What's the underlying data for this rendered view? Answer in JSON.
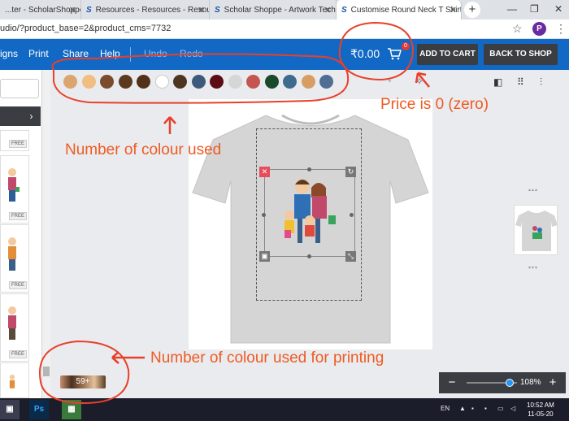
{
  "browser": {
    "tabs": [
      {
        "title": "...ter - ScholarShoppe",
        "active": false
      },
      {
        "title": "Resources - Resources - Resour",
        "active": false
      },
      {
        "title": "Scholar Shoppe - Artwork Techn",
        "active": false
      },
      {
        "title": "Customise Round Neck T Shirt |",
        "active": true
      }
    ],
    "new_tab": "+",
    "url": "udio/?product_base=2&product_cms=7732",
    "profile_initial": "P"
  },
  "app": {
    "menu": [
      "igns",
      "Print",
      "Share",
      "Help"
    ],
    "undo": "Undo",
    "redo": "Redo",
    "price": "₹0.00",
    "cart_count": "0",
    "add_to_cart": "ADD TO CART",
    "back_to_shop": "BACK TO SHOP"
  },
  "colors": [
    "#dba56f",
    "#f0bd82",
    "#7a4b2c",
    "#5c3a20",
    "#53301b",
    "#ffffff",
    "#4e3520",
    "#3d5a7c",
    "#5c0c12",
    "#d6d6d6",
    "#c5554f",
    "#184a2b",
    "#3f6b8f",
    "#d79e63",
    "#4f6e93"
  ],
  "sidebar": {
    "next_icon": "chevron-right-icon",
    "free_label": "FREE"
  },
  "palette_chip": "59+",
  "zoom": {
    "minus": "−",
    "plus": "+",
    "level": "108%"
  },
  "taskbar": {
    "lang": "EN",
    "time": "10:52 AM",
    "date": "11-05-20"
  },
  "annotations": {
    "price": "Price is 0 (zero)",
    "colours": "Number of colour used",
    "printing": "Number of colour used for printing"
  },
  "accent_colors": {
    "header": "#1269c5",
    "annotation": "#f05a22",
    "button": "#3a3d42"
  }
}
